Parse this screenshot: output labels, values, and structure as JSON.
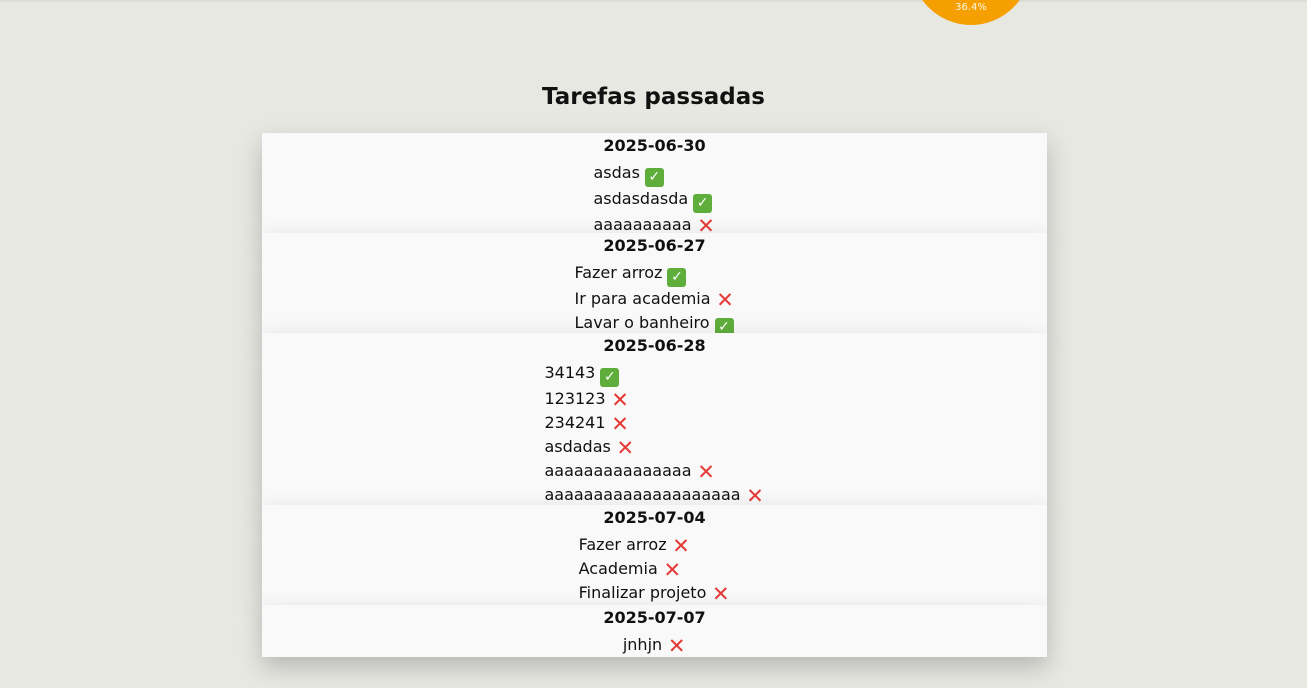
{
  "chart_widget": {
    "percent_label": "36.4%",
    "color": "#f5a000"
  },
  "page": {
    "title": "Tarefas passadas"
  },
  "status_icons": {
    "done": "✓",
    "fail": "✕"
  },
  "groups": [
    {
      "date": "2025-06-30",
      "tasks": [
        {
          "name": "asdas",
          "status": "done"
        },
        {
          "name": "asdasdasda",
          "status": "done"
        },
        {
          "name": "aaaaaaaaaa",
          "status": "fail"
        }
      ]
    },
    {
      "date": "2025-06-27",
      "tasks": [
        {
          "name": "Fazer arroz",
          "status": "done"
        },
        {
          "name": "Ir para academia",
          "status": "fail"
        },
        {
          "name": "Lavar o banheiro",
          "status": "done"
        }
      ]
    },
    {
      "date": "2025-06-28",
      "tasks": [
        {
          "name": "34143",
          "status": "done"
        },
        {
          "name": "123123",
          "status": "fail"
        },
        {
          "name": "234241",
          "status": "fail"
        },
        {
          "name": "asdadas",
          "status": "fail"
        },
        {
          "name": "aaaaaaaaaaaaaaa",
          "status": "fail"
        },
        {
          "name": "aaaaaaaaaaaaaaaaaaaa",
          "status": "fail"
        }
      ]
    },
    {
      "date": "2025-07-04",
      "tasks": [
        {
          "name": "Fazer arroz",
          "status": "fail"
        },
        {
          "name": "Academia",
          "status": "fail"
        },
        {
          "name": "Finalizar projeto",
          "status": "fail"
        }
      ]
    },
    {
      "date": "2025-07-07",
      "tasks": [
        {
          "name": "jnhjn",
          "status": "fail"
        }
      ]
    }
  ]
}
